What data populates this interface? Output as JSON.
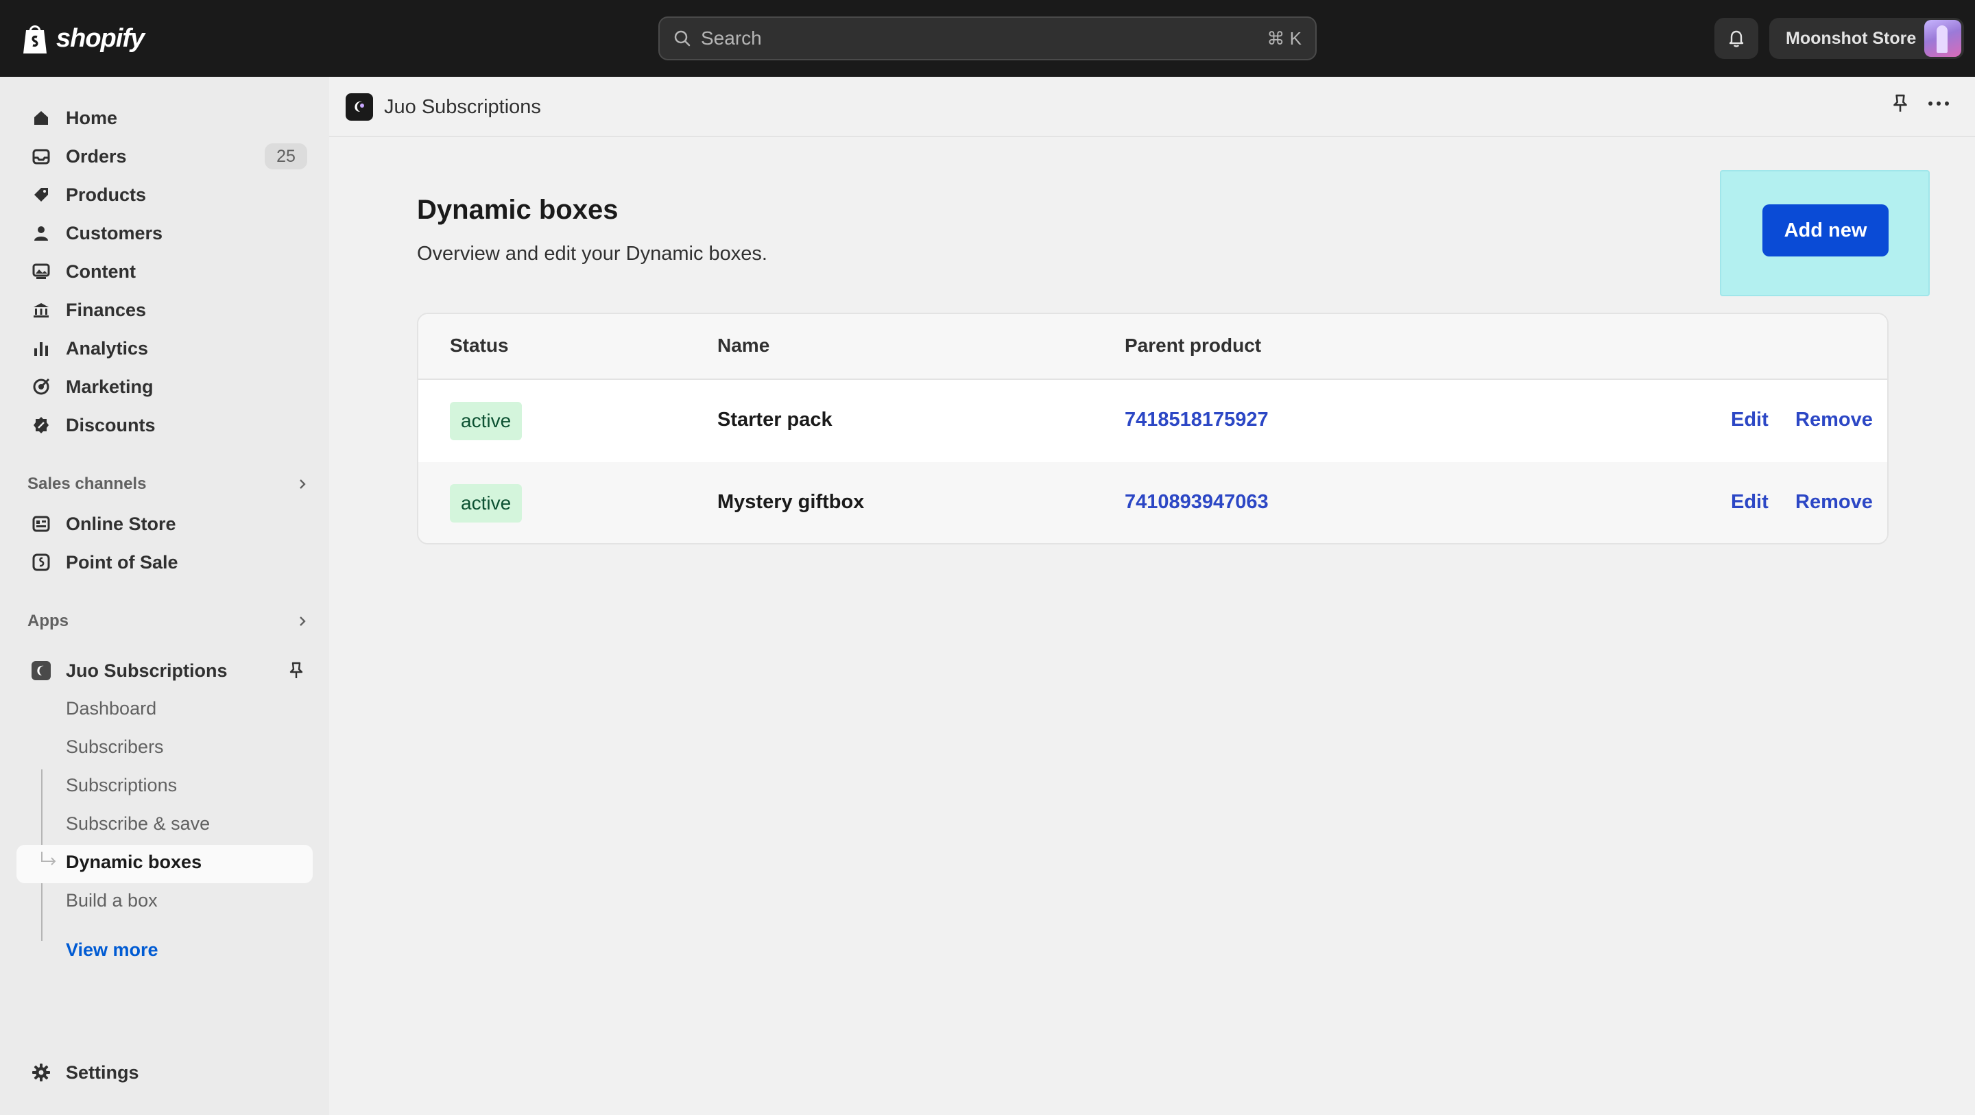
{
  "topbar": {
    "logo_text": "shopify",
    "search_placeholder": "Search",
    "search_shortcut": "⌘ K",
    "store_name": "Moonshot Store"
  },
  "sidebar": {
    "items": [
      {
        "label": "Home",
        "icon": "home-icon"
      },
      {
        "label": "Orders",
        "icon": "inbox-icon",
        "badge": "25"
      },
      {
        "label": "Products",
        "icon": "tag-icon"
      },
      {
        "label": "Customers",
        "icon": "person-icon"
      },
      {
        "label": "Content",
        "icon": "image-icon"
      },
      {
        "label": "Finances",
        "icon": "bank-icon"
      },
      {
        "label": "Analytics",
        "icon": "bar-chart-icon"
      },
      {
        "label": "Marketing",
        "icon": "target-icon"
      },
      {
        "label": "Discounts",
        "icon": "discount-icon"
      }
    ],
    "sales_channels": {
      "title": "Sales channels",
      "items": [
        {
          "label": "Online Store",
          "icon": "store-icon"
        },
        {
          "label": "Point of Sale",
          "icon": "pos-icon"
        }
      ]
    },
    "apps": {
      "title": "Apps",
      "app_name": "Juo Subscriptions",
      "sub_items": [
        "Dashboard",
        "Subscribers",
        "Subscriptions",
        "Subscribe & save",
        "Dynamic boxes",
        "Build a box"
      ],
      "active_sub": "Dynamic boxes",
      "view_more": "View more"
    },
    "settings_label": "Settings"
  },
  "appbar": {
    "title": "Juo Subscriptions"
  },
  "page": {
    "title": "Dynamic boxes",
    "subtitle": "Overview and edit your Dynamic boxes.",
    "add_button": "Add new"
  },
  "table": {
    "headers": [
      "Status",
      "Name",
      "Parent product"
    ],
    "rows": [
      {
        "status": "active",
        "name": "Starter pack",
        "parent_product": "7418518175927",
        "edit": "Edit",
        "remove": "Remove"
      },
      {
        "status": "active",
        "name": "Mystery giftbox",
        "parent_product": "7410893947063",
        "edit": "Edit",
        "remove": "Remove"
      }
    ]
  },
  "colors": {
    "topbar": "#1a1a1a",
    "accent_button": "#0a4bd6",
    "link": "#2c47c5",
    "status_bg": "#d4f5dc",
    "highlight": "#b3f0f0"
  }
}
